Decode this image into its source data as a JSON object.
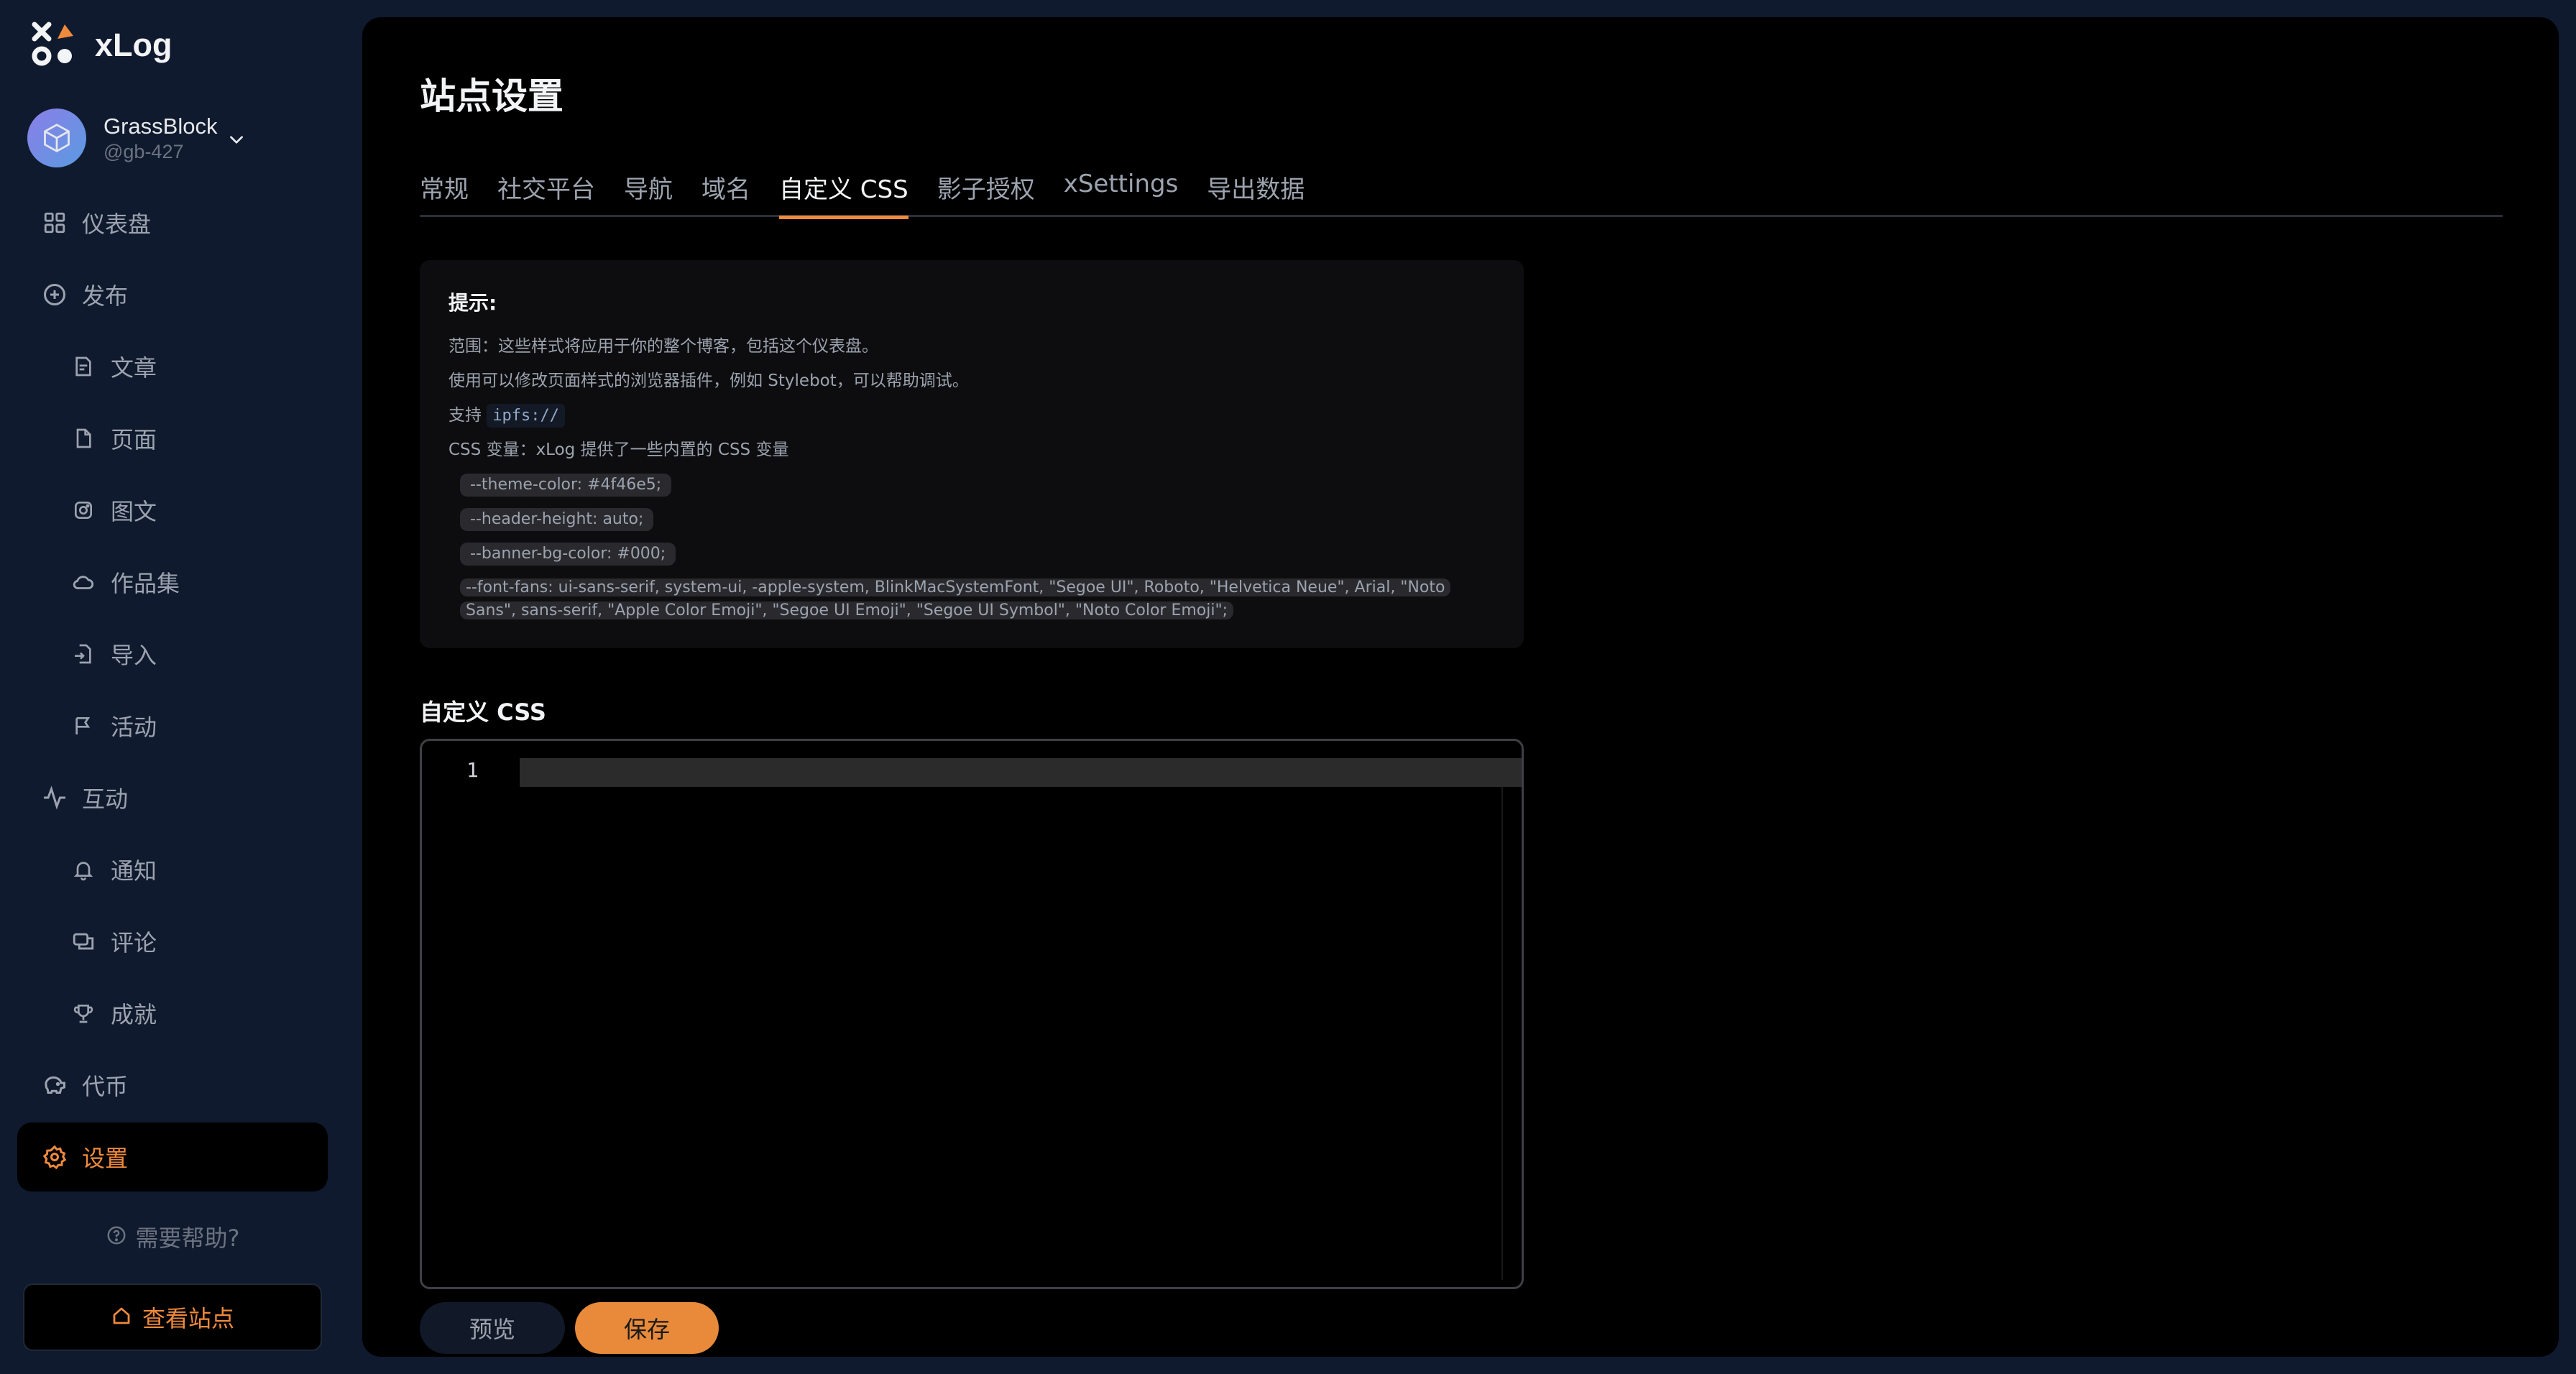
{
  "app": {
    "name": "xLog"
  },
  "user": {
    "name": "GrassBlock",
    "handle": "@gb-427"
  },
  "sidebar": {
    "items": [
      {
        "label": "仪表盘",
        "icon": "grid-icon",
        "level": "top"
      },
      {
        "label": "发布",
        "icon": "plus-circle-icon",
        "level": "top"
      },
      {
        "label": "文章",
        "icon": "document-icon",
        "level": "sub"
      },
      {
        "label": "页面",
        "icon": "page-icon",
        "level": "sub"
      },
      {
        "label": "图文",
        "icon": "instagram-icon",
        "level": "sub"
      },
      {
        "label": "作品集",
        "icon": "cloud-icon",
        "level": "sub"
      },
      {
        "label": "导入",
        "icon": "import-icon",
        "level": "sub"
      },
      {
        "label": "活动",
        "icon": "flag-icon",
        "level": "sub"
      },
      {
        "label": "互动",
        "icon": "activity-icon",
        "level": "top"
      },
      {
        "label": "通知",
        "icon": "bell-icon",
        "level": "sub"
      },
      {
        "label": "评论",
        "icon": "chat-icon",
        "level": "sub"
      },
      {
        "label": "成就",
        "icon": "trophy-icon",
        "level": "sub"
      },
      {
        "label": "代币",
        "icon": "piggy-bank-icon",
        "level": "top"
      },
      {
        "label": "设置",
        "icon": "gear-icon",
        "level": "top",
        "active": true
      }
    ],
    "help_label": "需要帮助?",
    "view_site_label": "查看站点"
  },
  "main": {
    "title": "站点设置",
    "tabs": [
      {
        "label": "常规"
      },
      {
        "label": "社交平台"
      },
      {
        "label": "导航"
      },
      {
        "label": "域名"
      },
      {
        "label": "自定义 CSS",
        "active": true
      },
      {
        "label": "影子授权"
      },
      {
        "label": "xSettings"
      },
      {
        "label": "导出数据"
      }
    ],
    "tip": {
      "title": "提示:",
      "line1": "范围：这些样式将应用于你的整个博客，包括这个仪表盘。",
      "line2": "使用可以修改页面样式的浏览器插件，例如 Stylebot，可以帮助调试。",
      "line3_prefix": "支持",
      "line3_code": "ipfs://",
      "line4": "CSS 变量：xLog 提供了一些内置的 CSS 变量",
      "vars": [
        "--theme-color: #4f46e5;",
        "--header-height: auto;",
        "--banner-bg-color: #000;"
      ],
      "font_var": "--font-fans: ui-sans-serif, system-ui, -apple-system, BlinkMacSystemFont, \"Segoe UI\", Roboto, \"Helvetica Neue\", Arial, \"Noto Sans\", sans-serif, \"Apple Color Emoji\", \"Segoe UI Emoji\", \"Segoe UI Symbol\", \"Noto Color Emoji\";"
    },
    "css_label": "自定义 CSS",
    "editor": {
      "line_number": "1",
      "content": ""
    },
    "buttons": {
      "preview": "预览",
      "save": "保存"
    }
  },
  "colors": {
    "accent": "#ef8a3c",
    "sidebar_bg": "#0f1a2e",
    "panel_bg": "#000000"
  }
}
